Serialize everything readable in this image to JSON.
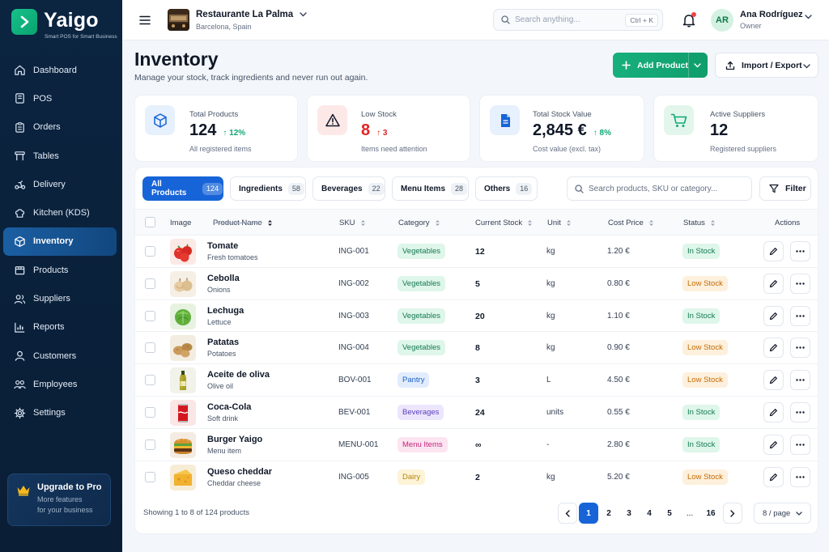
{
  "brand": {
    "name": "Yaigo",
    "tagline": "Smart POS for Smart Business"
  },
  "sidebar": {
    "items": [
      {
        "label": "Dashboard",
        "icon": "home-icon"
      },
      {
        "label": "POS",
        "icon": "pos-icon"
      },
      {
        "label": "Orders",
        "icon": "clipboard-icon"
      },
      {
        "label": "Tables",
        "icon": "table-icon"
      },
      {
        "label": "Delivery",
        "icon": "scooter-icon"
      },
      {
        "label": "Kitchen (KDS)",
        "icon": "chef-hat-icon"
      },
      {
        "label": "Inventory",
        "icon": "box-icon",
        "active": true
      },
      {
        "label": "Products",
        "icon": "package-icon"
      },
      {
        "label": "Suppliers",
        "icon": "users-icon"
      },
      {
        "label": "Reports",
        "icon": "bar-chart-icon"
      },
      {
        "label": "Customers",
        "icon": "user-icon"
      },
      {
        "label": "Employees",
        "icon": "team-icon"
      },
      {
        "label": "Settings",
        "icon": "gear-icon"
      }
    ],
    "upgrade": {
      "title": "Upgrade to Pro",
      "desc1": "More features",
      "desc2": "for your business"
    }
  },
  "topbar": {
    "restaurant": "Restaurante La Palma",
    "city": "Barcelona, Spain",
    "search_placeholder": "Search anything...",
    "shortcut": "Ctrl + K",
    "user": {
      "initials": "AR",
      "name": "Ana Rodríguez",
      "role": "Owner"
    }
  },
  "page": {
    "title": "Inventory",
    "subtitle": "Manage your stock, track ingredients and never run out again.",
    "add_label": "Add Product",
    "import_label": "Import / Export"
  },
  "stats": [
    {
      "label": "Total Products",
      "value": "124",
      "delta": "12%",
      "note": "All registered items"
    },
    {
      "label": "Low Stock",
      "value": "8",
      "delta": "3",
      "note": "Items need attention"
    },
    {
      "label": "Total Stock Value",
      "value": "2,845 €",
      "delta": "8%",
      "note": "Cost value (excl. tax)"
    },
    {
      "label": "Active Suppliers",
      "value": "12",
      "note": "Registered suppliers"
    }
  ],
  "tabs": [
    {
      "label": "All Products",
      "count": "124"
    },
    {
      "label": "Ingredients",
      "count": "58"
    },
    {
      "label": "Beverages",
      "count": "22"
    },
    {
      "label": "Menu Items",
      "count": "28"
    },
    {
      "label": "Others",
      "count": "16"
    }
  ],
  "table": {
    "search_placeholder": "Search products, SKU or category...",
    "filter_label": "Filter",
    "headers": {
      "image": "Image",
      "name": "Product Name",
      "sku": "SKU",
      "category": "Category",
      "stock": "Current Stock",
      "unit": "Unit",
      "cost": "Cost Price",
      "status": "Status",
      "actions": "Actions"
    },
    "rows": [
      {
        "name": "Tomate",
        "sub": "Fresh tomatoes",
        "sku": "ING-001",
        "category": "Vegetables",
        "stock": "12",
        "unit": "kg",
        "cost": "1.20 €",
        "status": "In Stock"
      },
      {
        "name": "Cebolla",
        "sub": "Onions",
        "sku": "ING-002",
        "category": "Vegetables",
        "stock": "5",
        "unit": "kg",
        "cost": "0.80 €",
        "status": "Low Stock"
      },
      {
        "name": "Lechuga",
        "sub": "Lettuce",
        "sku": "ING-003",
        "category": "Vegetables",
        "stock": "20",
        "unit": "kg",
        "cost": "1.10 €",
        "status": "In Stock"
      },
      {
        "name": "Patatas",
        "sub": "Potatoes",
        "sku": "ING-004",
        "category": "Vegetables",
        "stock": "8",
        "unit": "kg",
        "cost": "0.90 €",
        "status": "Low Stock"
      },
      {
        "name": "Aceite de oliva",
        "sub": "Olive oil",
        "sku": "BOV-001",
        "category": "Pantry",
        "stock": "3",
        "unit": "L",
        "cost": "4.50 €",
        "status": "Low Stock"
      },
      {
        "name": "Coca-Cola",
        "sub": "Soft drink",
        "sku": "BEV-001",
        "category": "Beverages",
        "stock": "24",
        "unit": "units",
        "cost": "0.55 €",
        "status": "In Stock"
      },
      {
        "name": "Burger Yaigo",
        "sub": "Menu item",
        "sku": "MENU-001",
        "category": "Menu Items",
        "stock": "∞",
        "unit": "-",
        "cost": "2.80 €",
        "status": "In Stock"
      },
      {
        "name": "Queso cheddar",
        "sub": "Cheddar cheese",
        "sku": "ING-005",
        "category": "Dairy",
        "stock": "2",
        "unit": "kg",
        "cost": "5.20 €",
        "status": "Low Stock"
      }
    ],
    "footer": "Showing 1 to 8 of 124 products",
    "pages": [
      "1",
      "2",
      "3",
      "4",
      "5",
      "...",
      "16"
    ],
    "per_page": "8 / page"
  },
  "colors": {
    "accent": "#1764d8",
    "green": "#12a873",
    "red": "#e02424",
    "sidebar": "#0b2440"
  }
}
